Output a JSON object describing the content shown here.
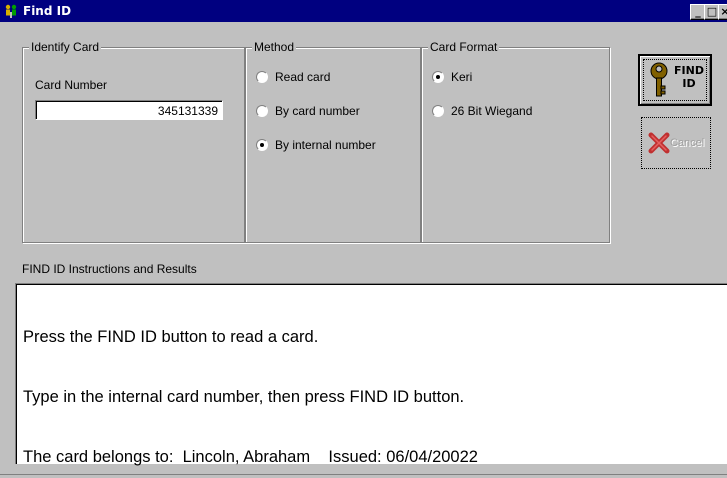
{
  "window": {
    "title": "Find ID",
    "minimize_glyph": "_",
    "maximize_glyph": "□",
    "close_glyph": "×"
  },
  "identify_card": {
    "legend": "Identify Card",
    "card_number_label": "Card Number",
    "card_number_value": "345131339"
  },
  "method": {
    "legend": "Method",
    "options": [
      {
        "label": "Read card",
        "selected": false
      },
      {
        "label": "By card number",
        "selected": false
      },
      {
        "label": "By internal number",
        "selected": true
      }
    ]
  },
  "card_format": {
    "legend": "Card Format",
    "options": [
      {
        "label": "Keri",
        "selected": true
      },
      {
        "label": "26 Bit Wiegand",
        "selected": false
      }
    ]
  },
  "actions": {
    "find_id_line1": "FIND",
    "find_id_line2": "ID",
    "find_icon": "key-icon",
    "cancel_label": "Cancel",
    "cancel_icon": "red-x-icon",
    "cancel_enabled": false
  },
  "results": {
    "label": "FIND ID Instructions and Results",
    "lines": [
      "Press the FIND ID button to read a card.",
      "Type in the internal card number, then press FIND ID button.",
      "The card belongs to:  Lincoln, Abraham    Issued: 06/04/20022"
    ]
  },
  "colors": {
    "titlebar": "#000080",
    "face": "#c0c0c0",
    "cancel_x": "#c00000",
    "key": "#806000"
  }
}
